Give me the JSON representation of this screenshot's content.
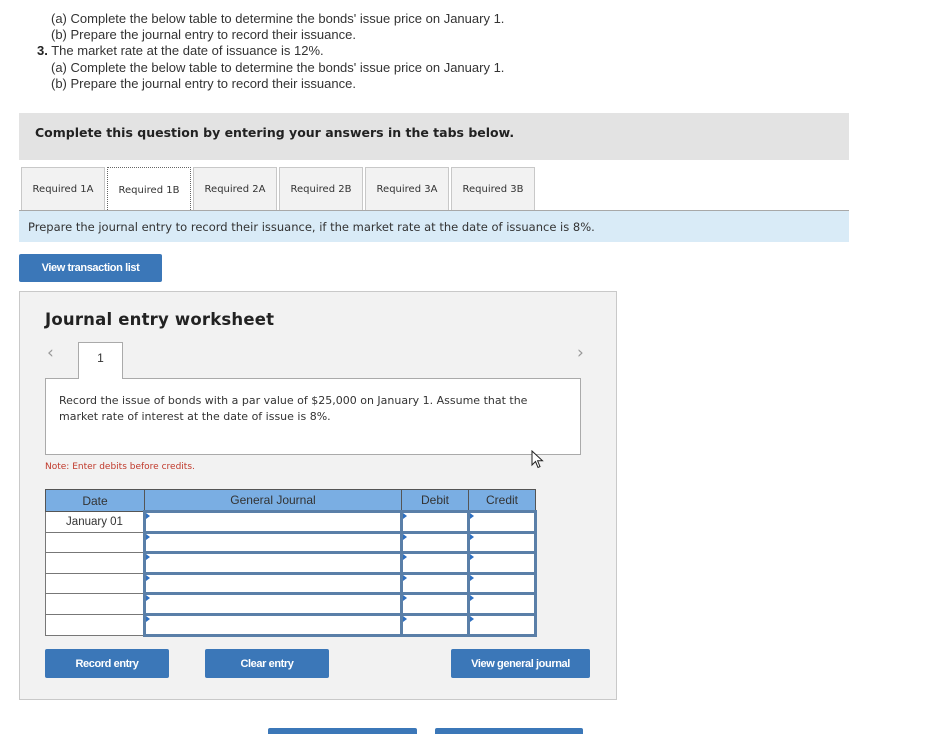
{
  "intro": {
    "line_2a": "(a) Complete the below table to determine the bonds' issue price on January 1.",
    "line_2b": "(b) Prepare the journal entry to record their issuance.",
    "item3_number": "3.",
    "item3_text": "The market rate at the date of issuance is 12%.",
    "line_3a": "(a) Complete the below table to determine the bonds' issue price on January 1.",
    "line_3b": "(b) Prepare the journal entry to record their issuance."
  },
  "banner": "Complete this question by entering your answers in the tabs below.",
  "tabs": [
    {
      "label": "Required 1A",
      "active": false
    },
    {
      "label": "Required 1B",
      "active": true
    },
    {
      "label": "Required 2A",
      "active": false
    },
    {
      "label": "Required 2B",
      "active": false
    },
    {
      "label": "Required 3A",
      "active": false
    },
    {
      "label": "Required 3B",
      "active": false
    }
  ],
  "instruction": "Prepare the journal entry to record their issuance, if the market rate at the date of issuance is 8%.",
  "buttons": {
    "view_transaction_list": "View transaction list",
    "record_entry": "Record entry",
    "clear_entry": "Clear entry",
    "view_general_journal": "View general journal"
  },
  "worksheet": {
    "title": "Journal entry worksheet",
    "prev_icon": "‹",
    "next_icon": "›",
    "page": "1",
    "description": "Record the issue of bonds with a par value of $25,000 on January 1. Assume that the market rate of interest at the date of issue is 8%.",
    "note": "Note: Enter debits before credits.",
    "table": {
      "headers": [
        "Date",
        "General Journal",
        "Debit",
        "Credit"
      ],
      "rows": [
        {
          "date": "January 01",
          "account": "",
          "debit": "",
          "credit": ""
        },
        {
          "date": "",
          "account": "",
          "debit": "",
          "credit": ""
        },
        {
          "date": "",
          "account": "",
          "debit": "",
          "credit": ""
        },
        {
          "date": "",
          "account": "",
          "debit": "",
          "credit": ""
        },
        {
          "date": "",
          "account": "",
          "debit": "",
          "credit": ""
        },
        {
          "date": "",
          "account": "",
          "debit": "",
          "credit": ""
        }
      ]
    }
  },
  "colors": {
    "button": "#3b77b8",
    "table_header": "#7aaee3",
    "instruction_bg": "#d9ebf7",
    "note": "#c0392b"
  }
}
